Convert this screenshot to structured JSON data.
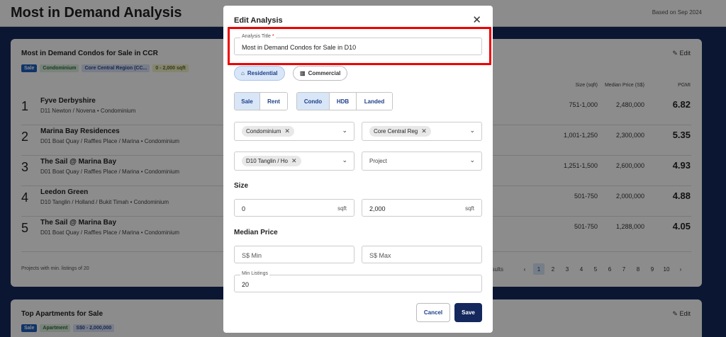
{
  "header": {
    "title": "Most in Demand Analysis",
    "based_on": "Based on Sep 2024"
  },
  "card1": {
    "title": "Most in Demand Condos for Sale in CCR",
    "edit_label": "Edit",
    "tags": [
      "Sale",
      "Condominium",
      "Core Central Region (CC...",
      "0 - 2,000 sqft"
    ],
    "columns": {
      "size": "Size (sqft)",
      "price": "Median Price (S$)",
      "pgmi": "PGMI"
    },
    "rows": [
      {
        "rank": "1",
        "name": "Fyve Derbyshire",
        "location": "D11 Newton / Novena",
        "type": "Condominium",
        "size": "751-1,000",
        "price": "2,480,000",
        "pgmi": "6.82"
      },
      {
        "rank": "2",
        "name": "Marina Bay Residences",
        "location": "D01 Boat Quay / Raffles Place / Marina",
        "type": "Condominium",
        "size": "1,001-1,250",
        "price": "2,300,000",
        "pgmi": "5.35"
      },
      {
        "rank": "3",
        "name": "The Sail @ Marina Bay",
        "location": "D01 Boat Quay / Raffles Place / Marina",
        "type": "Condominium",
        "size": "1,251-1,500",
        "price": "2,600,000",
        "pgmi": "4.93"
      },
      {
        "rank": "4",
        "name": "Leedon Green",
        "location": "D10 Tanglin / Holland / Bukit Timah",
        "type": "Condominium",
        "size": "501-750",
        "price": "2,000,000",
        "pgmi": "4.88"
      },
      {
        "rank": "5",
        "name": "The Sail @ Marina Bay",
        "location": "D01 Boat Quay / Raffles Place / Marina",
        "type": "Condominium",
        "size": "501-750",
        "price": "1,288,000",
        "pgmi": "4.05"
      }
    ],
    "footer_note": "Projects with min. listings of 20",
    "pager": {
      "results_label": "Results",
      "prev": "‹",
      "next": "›",
      "pages": [
        "1",
        "2",
        "3",
        "4",
        "5",
        "6",
        "7",
        "8",
        "9",
        "10"
      ],
      "active": "1"
    }
  },
  "card2": {
    "title": "Top Apartments for Sale",
    "edit_label": "Edit",
    "tags": [
      "Sale",
      "Apartment",
      "S$0 - 2,000,000"
    ]
  },
  "modal": {
    "title": "Edit Analysis",
    "close": "✕",
    "analysis_title": {
      "label": "Analysis Title",
      "required": "*",
      "value": "Most in Demand Condos for Sale in D10"
    },
    "category": {
      "residential": "Residential",
      "commercial": "Commercial",
      "selected": "Residential"
    },
    "listing_type": {
      "options": [
        "Sale",
        "Rent"
      ],
      "selected": "Sale"
    },
    "property_type": {
      "options": [
        "Condo",
        "HDB",
        "Landed"
      ],
      "selected": "Condo"
    },
    "property_sub_type": {
      "chip": "Condominium"
    },
    "region": {
      "chip": "Core Central Reg"
    },
    "district": {
      "chip": "D10 Tanglin / Ho"
    },
    "project": {
      "placeholder": "Project"
    },
    "size": {
      "label": "Size",
      "min": "0",
      "max": "2,000",
      "unit": "sqft"
    },
    "median_price": {
      "label": "Median Price",
      "min_placeholder": "S$ Min",
      "max_placeholder": "S$ Max"
    },
    "min_listings": {
      "label": "Min Listings",
      "value": "20"
    },
    "cancel_label": "Cancel",
    "save_label": "Save"
  },
  "colors": {
    "accent": "#14285e",
    "highlight": "#e00000",
    "selected_bg": "#d8e6f7"
  }
}
